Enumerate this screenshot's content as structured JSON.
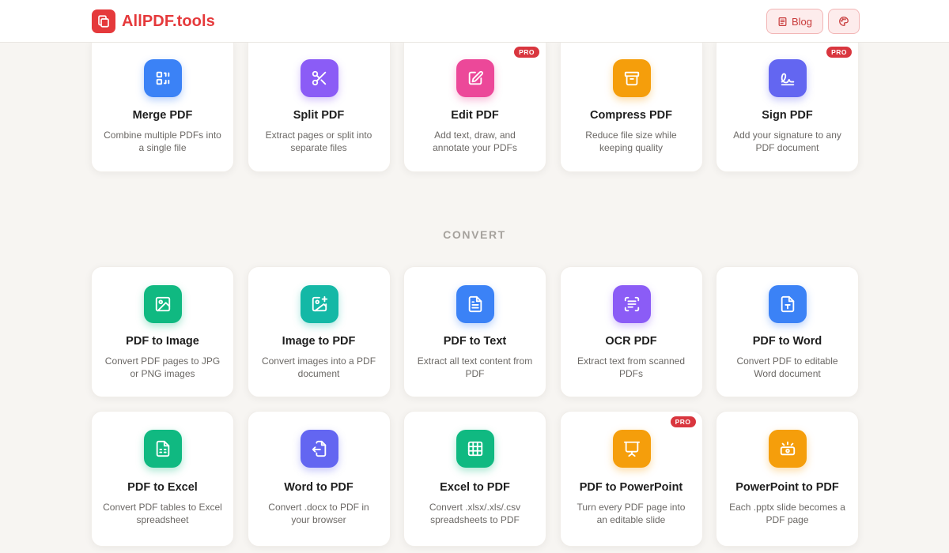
{
  "header": {
    "brand": "AllPDF.tools",
    "blog_label": "Blog"
  },
  "colors": {
    "brand": "#e5393b",
    "pro_badge": "#d9363e",
    "background": "#f7f5f2"
  },
  "organize_tools": [
    {
      "title": "Merge PDF",
      "desc": "Combine multiple PDFs into a single file",
      "icon": "merge-icon",
      "color": "#3b82f6"
    },
    {
      "title": "Split PDF",
      "desc": "Extract pages or split into separate files",
      "icon": "scissors-icon",
      "color": "#8b5cf6"
    },
    {
      "title": "Edit PDF",
      "desc": "Add text, draw, and annotate your PDFs",
      "icon": "edit-icon",
      "color": "#ec4899",
      "badge": "PRO"
    },
    {
      "title": "Compress PDF",
      "desc": "Reduce file size while keeping quality",
      "icon": "archive-icon",
      "color": "#f59e0b"
    },
    {
      "title": "Sign PDF",
      "desc": "Add your signature to any PDF document",
      "icon": "signature-icon",
      "color": "#6366f1",
      "badge": "PRO"
    }
  ],
  "convert_section_title": "CONVERT",
  "convert_tools_row1": [
    {
      "title": "PDF to Image",
      "desc": "Convert PDF pages to JPG or PNG images",
      "icon": "image-icon",
      "color": "#10b981"
    },
    {
      "title": "Image to PDF",
      "desc": "Convert images into a PDF document",
      "icon": "image-plus-icon",
      "color": "#14b8a6"
    },
    {
      "title": "PDF to Text",
      "desc": "Extract all text content from PDF",
      "icon": "file-text-icon",
      "color": "#3b82f6"
    },
    {
      "title": "OCR PDF",
      "desc": "Extract text from scanned PDFs",
      "icon": "scan-text-icon",
      "color": "#8b5cf6"
    },
    {
      "title": "PDF to Word",
      "desc": "Convert PDF to editable Word document",
      "icon": "file-type-icon",
      "color": "#3b82f6"
    }
  ],
  "convert_tools_row2": [
    {
      "title": "PDF to Excel",
      "desc": "Convert PDF tables to Excel spreadsheet",
      "icon": "file-spreadsheet-icon",
      "color": "#10b981"
    },
    {
      "title": "Word to PDF",
      "desc": "Convert .docx to PDF in your browser",
      "icon": "file-import-icon",
      "color": "#6366f1"
    },
    {
      "title": "Excel to PDF",
      "desc": "Convert .xlsx/.xls/.csv spreadsheets to PDF",
      "icon": "table-icon",
      "color": "#10b981"
    },
    {
      "title": "PDF to PowerPoint",
      "desc": "Turn every PDF page into an editable slide",
      "icon": "presentation-icon",
      "color": "#f59e0b",
      "badge": "PRO"
    },
    {
      "title": "PowerPoint to PDF",
      "desc": "Each .pptx slide becomes a PDF page",
      "icon": "slides-icon",
      "color": "#f59e0b"
    }
  ]
}
